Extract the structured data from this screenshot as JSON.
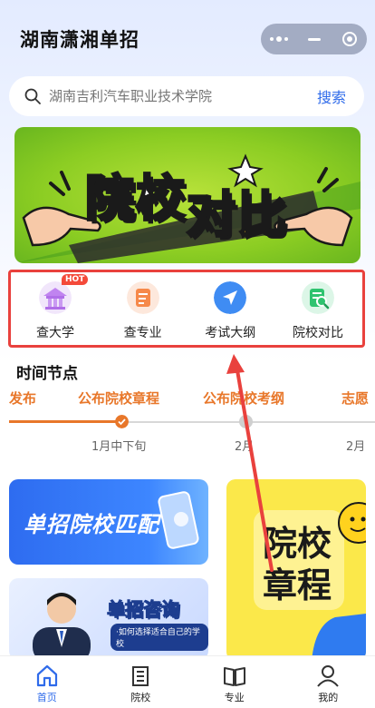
{
  "app": {
    "title": "湖南潇湘单招"
  },
  "search": {
    "placeholder": "湖南吉利汽车职业技术学院",
    "button_label": "搜索"
  },
  "banner": {
    "text_part1": "院校",
    "text_part2": "对比"
  },
  "quick_nav": {
    "items": [
      {
        "label": "查大学",
        "badge": "HOT",
        "icon": "university-icon"
      },
      {
        "label": "查专业",
        "icon": "major-icon"
      },
      {
        "label": "考试大纲",
        "icon": "outline-icon"
      },
      {
        "label": "院校对比",
        "icon": "compare-icon"
      }
    ]
  },
  "timeline": {
    "title": "时间节点",
    "events": [
      {
        "label": "发布",
        "date": ""
      },
      {
        "label": "公布院校章程",
        "date": "1月中下旬"
      },
      {
        "label": "公布院校考纲",
        "date": "2月"
      },
      {
        "label": "志愿",
        "date": "2月"
      }
    ]
  },
  "cards": {
    "match": "单招院校匹配",
    "consult_title": "单招咨询",
    "consult_subtitle": "·如何选择适合自己的学校",
    "charter_line1": "院校",
    "charter_line2": "章程"
  },
  "tabbar": {
    "items": [
      {
        "label": "首页",
        "icon": "home-icon",
        "active": true
      },
      {
        "label": "院校",
        "icon": "building-icon"
      },
      {
        "label": "专业",
        "icon": "book-icon"
      },
      {
        "label": "我的",
        "icon": "user-icon"
      }
    ]
  },
  "colors": {
    "accent": "#2f6bea",
    "timeline_orange": "#e8772a",
    "highlight_red": "#e9413d",
    "banner_green": "#8ccd23"
  }
}
